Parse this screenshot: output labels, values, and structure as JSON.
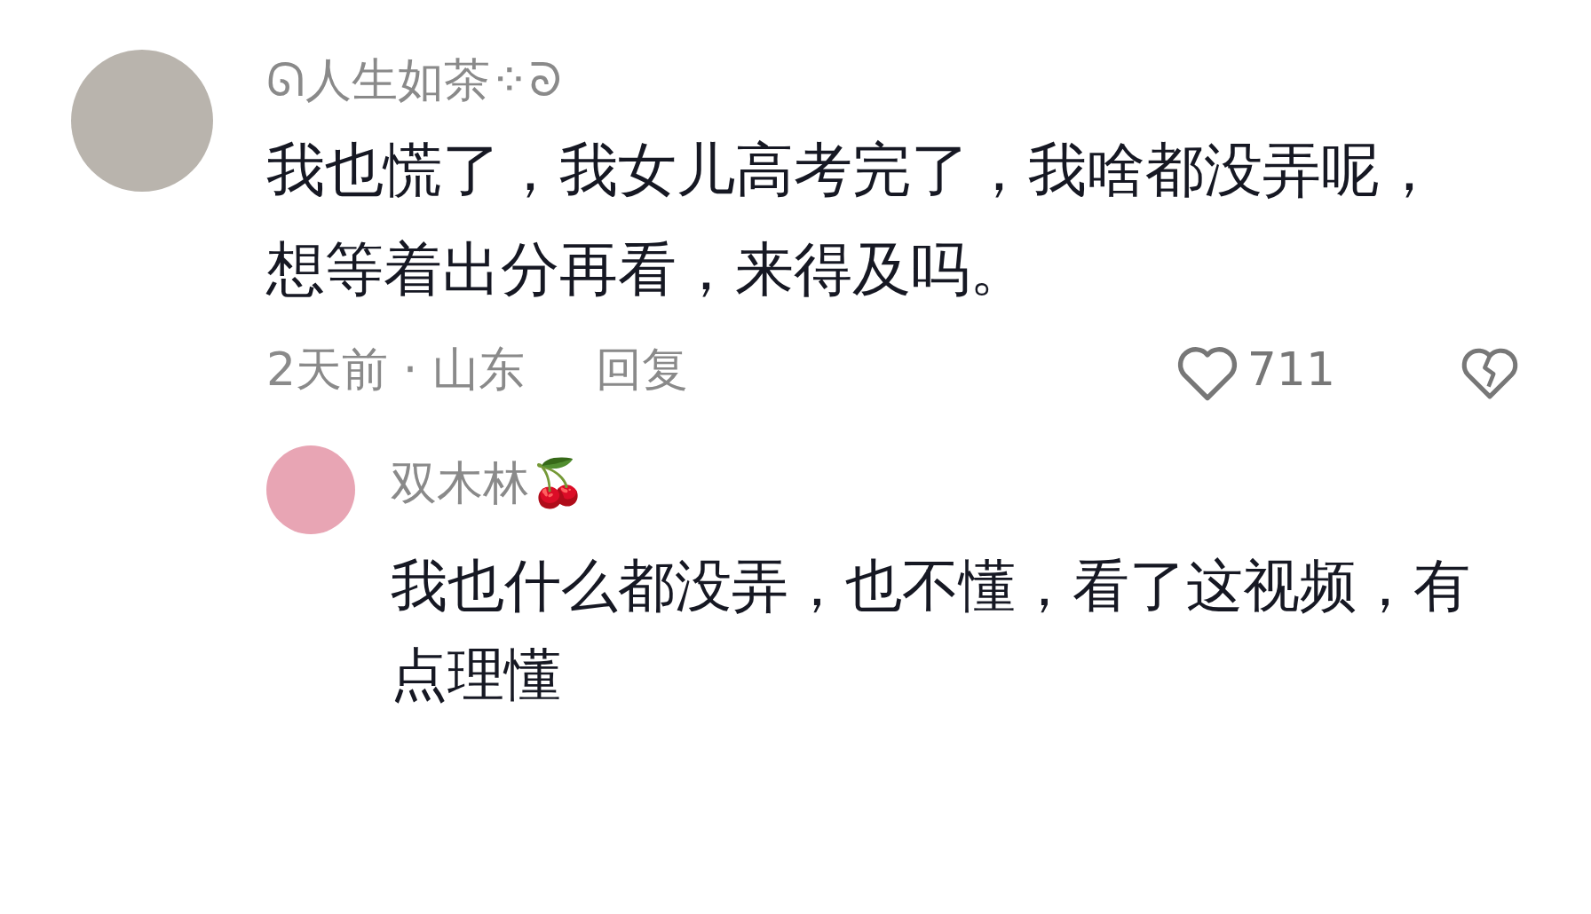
{
  "comment": {
    "username": "ᘏ人生如茶⁘ᘐ",
    "text": "我也慌了，我女儿高考完了，我啥都没弄呢，想等着出分再看，来得及吗。",
    "time": "2天前",
    "separator": "·",
    "location": "山东",
    "reply_label": "回复",
    "likes": "711",
    "liked": false,
    "replies": [
      {
        "username": "双木林🍒",
        "text": "我也什么都没弄，也不懂，看了这视频，有点理懂"
      }
    ]
  }
}
